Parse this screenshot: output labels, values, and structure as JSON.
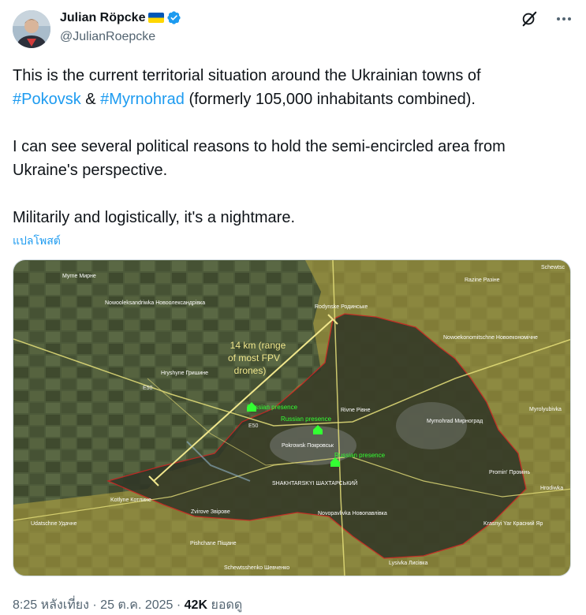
{
  "author": {
    "name": "Julian Röpcke",
    "handle": "@JulianRoepcke",
    "flag_icon": "ukraine-flag-icon",
    "verified_icon": "verified-badge-icon"
  },
  "icons": {
    "grok": "grok-icon",
    "more": "more-options-icon"
  },
  "tweet": {
    "p1_a": "This is the current territorial situation around the Ukrainian towns of",
    "tag1": "#Pokovsk",
    "amp": " & ",
    "tag2": "#Myrnohrad",
    "p1_b": " (formerly 105,000 inhabitants combined).",
    "p2": "I can see several political reasons to hold the semi-encircled area from Ukraine's perspective.",
    "p3": "Militarily and logistically, it's a nightmare."
  },
  "translate_link": "แปลโพสต์",
  "map": {
    "annotation_line1": "14 km (range",
    "annotation_line2": "of most FPV",
    "annotation_line3": "drones)",
    "russian_presence_1": "Russian presence",
    "russian_presence_2": "Russian presence",
    "russian_presence_3": "Russian presence",
    "places": {
      "myrne": "Myrne Мирне",
      "nowooleksandriwka": "Nowooleksandriwka Новоолександрівка",
      "rodynske": "Rodynske Родинське",
      "razine": "Razine Разіне",
      "schewtschenko_top": "Schewtsc",
      "nowoekonomitschne": "Nowoekonomitschne Новоекономічне",
      "hryshyne": "Hryshyne Гришине",
      "myrolyubivka": "Myrolyubivka",
      "rivne": "Rivne Рівне",
      "myrnohrad": "Myrnohrad Мирноград",
      "pokrowsk": "Pokrowsk Покровськ",
      "shakhtarskyi": "SHAKHTARSKYI ШАХТАРСЬКИЙ",
      "promin": "Promin' Промінь",
      "hrodiwka": "Hrodiwka",
      "kotlyne": "Kotlyne Котлине",
      "zvirove": "Zvirove Звірове",
      "novopavlivka": "Novopavlivka Новопавлівка",
      "krasnyi_yar": "Krasnyi Yar Красний Яр",
      "udatschne": "Udatschne Удачне",
      "pishchane": "Pishchane Піщане",
      "lysivka": "Lysivka Лисівка",
      "schewtschenko": "Schewtsshenko Шевченко",
      "e50_a": "E50",
      "e50_b": "E50"
    }
  },
  "meta": {
    "time_date": "8:25 หลังเที่ยง · 25 ต.ค. 2025 · ",
    "views_count": "42K",
    "views_label": " ยอดดู"
  },
  "colors": {
    "link": "#1d9bf0",
    "secondary_text": "#536471",
    "verified": "#1d9bf0",
    "russian_zone": "#b8a640",
    "ukrainian_zone_outline": "#cc2222",
    "annotation": "#f0e68c",
    "russian_presence_label": "#33ff33"
  }
}
